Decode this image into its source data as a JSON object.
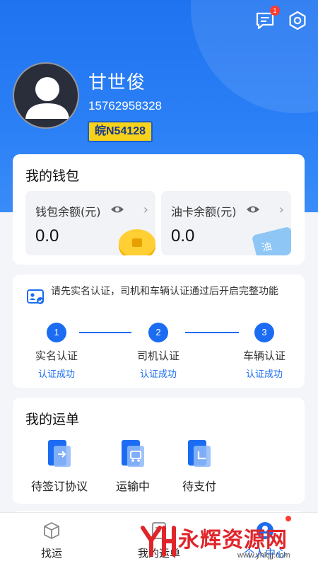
{
  "user": {
    "name": "甘世俊",
    "phone": "15762958328",
    "plate": "皖N54128"
  },
  "header": {
    "message_badge": "1",
    "icons": [
      "message-icon",
      "settings-icon"
    ]
  },
  "wallet": {
    "title": "我的钱包",
    "wallet_balance": {
      "label": "钱包余额(元)",
      "value": "0.0",
      "chevron": "›"
    },
    "fuel_balance": {
      "label": "油卡余额(元)",
      "value": "0.0",
      "chevron": "›",
      "card_text": "油"
    }
  },
  "certification": {
    "tip": "请先实名认证，司机和车辆认证通过后开启完整功能",
    "steps": [
      {
        "num": "1",
        "name": "实名认证",
        "status": "认证成功"
      },
      {
        "num": "2",
        "name": "司机认证",
        "status": "认证成功"
      },
      {
        "num": "3",
        "name": "车辆认证",
        "status": "认证成功"
      }
    ]
  },
  "orders": {
    "title": "我的运单",
    "items": [
      {
        "label": "待签订协议"
      },
      {
        "label": "运输中"
      },
      {
        "label": "待支付"
      }
    ]
  },
  "tabbar": {
    "items": [
      {
        "label": "找运"
      },
      {
        "label": "我的运单"
      },
      {
        "label": "个人中心"
      }
    ]
  },
  "watermark": {
    "text": "永辉资源网",
    "url": "www.yhkjjj.com"
  },
  "colors": {
    "primary": "#1b6cf2",
    "header": "#2b80f6",
    "plate_bg": "#f7d21a",
    "badge": "#ff3b30"
  }
}
